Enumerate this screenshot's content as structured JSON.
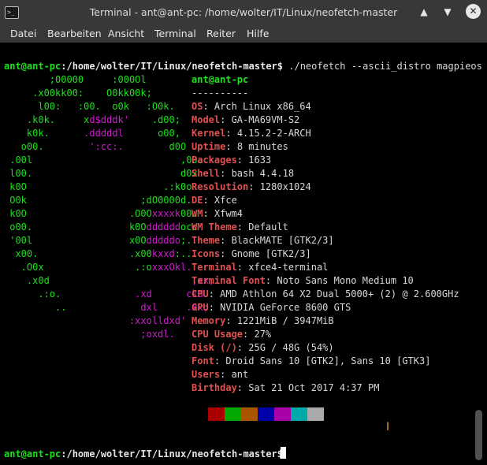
{
  "window": {
    "title": "Terminal - ant@ant-pc: /home/wolter/IT/Linux/neofetch-master"
  },
  "menu": [
    "Datei",
    "Bearbeiten",
    "Ansicht",
    "Terminal",
    "Reiter",
    "Hilfe"
  ],
  "prompt": {
    "user": "ant@ant-pc",
    "path": ":/home/wolter/IT/Linux/neofetch-master$",
    "command": " ./neofetch --ascii_distro magpieos"
  },
  "ascii": [
    {
      "g": "        ;00000     :000Ol",
      "m": ""
    },
    {
      "g": "     .x00kk00:    O0kk00k;",
      "m": ""
    },
    {
      "g": "      l00:   :00.  o0k   :O0k.",
      "m": ""
    },
    {
      "g": "    .k0k.     x",
      "m": "d$dddk'",
      "g2": "    .d00;"
    },
    {
      "g": "    k0k.      ",
      "m": ".dddddl",
      "g2": "      o00,"
    },
    {
      "g": "   o00.        ",
      "m": "':cc:.",
      "g2": "        d0O"
    },
    {
      "g": " .00l",
      "m": "",
      "g2": "                          ,00."
    },
    {
      "g": " l00.",
      "m": "",
      "g2": "                          d0x"
    },
    {
      "g": " k0O",
      "m": "",
      "g2": "                        .:k0o"
    },
    {
      "g": " O0k                    ;dO0000d.",
      "m": ""
    },
    {
      "g": " k0O                  .O0O",
      "m": "xxxxk",
      "g2": "00:"
    },
    {
      "g": " o00.                 k0O",
      "m": "dddddd",
      "g2": "occ"
    },
    {
      "g": " '00l                 x0O",
      "m": "dddddo",
      "g2": ";.."
    },
    {
      "g": "  x00.                .x00",
      "m": "kxxd",
      "g2": ":.."
    },
    {
      "g": "   .O0x                .:o",
      "m": "xxxOkl.",
      "g2": ""
    },
    {
      "g": "    .x0d",
      "m": "                         ,xx,",
      "g2": ""
    },
    {
      "g": "      .:o.",
      "m": "             .xd      ckd",
      "g2": ""
    },
    {
      "g": "         ..",
      "m": "             dxl     .xx;",
      "g2": ""
    },
    {
      "g": "",
      "m": "                      :xxolldxd'",
      "g2": ""
    },
    {
      "g": "",
      "m": "                        ;oxdl.",
      "g2": ""
    }
  ],
  "info": {
    "header": "ant@ant-pc",
    "sep": "----------",
    "rows": [
      {
        "k": "OS",
        "v": "Arch Linux x86_64"
      },
      {
        "k": "Model",
        "v": "GA-MA69VM-S2"
      },
      {
        "k": "Kernel",
        "v": "4.15.2-2-ARCH"
      },
      {
        "k": "Uptime",
        "v": "8 minutes"
      },
      {
        "k": "Packages",
        "v": "1633"
      },
      {
        "k": "Shell",
        "v": "bash 4.4.18"
      },
      {
        "k": "Resolution",
        "v": "1280x1024"
      },
      {
        "k": "DE",
        "v": "Xfce"
      },
      {
        "k": "WM",
        "v": "Xfwm4"
      },
      {
        "k": "WM Theme",
        "v": "Default"
      },
      {
        "k": "Theme",
        "v": "BlackMATE [GTK2/3]"
      },
      {
        "k": "Icons",
        "v": "Gnome [GTK2/3]"
      },
      {
        "k": "Terminal",
        "v": "xfce4-terminal"
      },
      {
        "k": "Terminal Font",
        "v": "Noto Sans Mono Medium 10"
      },
      {
        "k": "CPU",
        "v": "AMD Athlon 64 X2 Dual 5000+ (2) @ 2.600GHz"
      },
      {
        "k": "GPU",
        "v": "NVIDIA GeForce 8600 GTS"
      },
      {
        "k": "Memory",
        "v": "1221MiB / 3947MiB"
      },
      {
        "k": "CPU Usage",
        "v": "27%"
      },
      {
        "k": "Disk (/)",
        "v": "25G / 48G (54%)"
      },
      {
        "k": "Font",
        "v": "Droid Sans 10 [GTK2], Sans 10 [GTK3]"
      },
      {
        "k": "Users",
        "v": "ant"
      },
      {
        "k": "Birthday",
        "v": "Sat 21 Oct 2017 4:37 PM"
      }
    ]
  },
  "palette": [
    "#000000",
    "#aa0000",
    "#00aa00",
    "#aa5500",
    "#0000aa",
    "#aa00aa",
    "#00aaaa",
    "#aaaaaa"
  ]
}
